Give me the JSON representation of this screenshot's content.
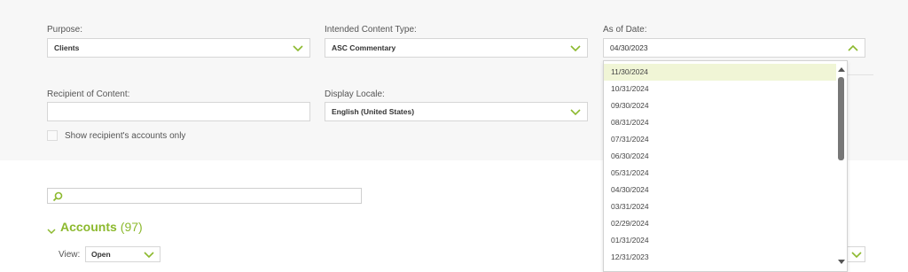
{
  "purpose": {
    "label": "Purpose:",
    "value": "Clients"
  },
  "content_type": {
    "label": "Intended Content Type:",
    "value": "ASC Commentary"
  },
  "as_of_date": {
    "label": "As of Date:",
    "value": "04/30/2023",
    "options": [
      "11/30/2024",
      "10/31/2024",
      "09/30/2024",
      "08/31/2024",
      "07/31/2024",
      "06/30/2024",
      "05/31/2024",
      "04/30/2024",
      "03/31/2024",
      "02/29/2024",
      "01/31/2024",
      "12/31/2023"
    ],
    "highlighted": "11/30/2024"
  },
  "recipient": {
    "label": "Recipient of Content:",
    "value": ""
  },
  "locale": {
    "label": "Display Locale:",
    "value": "English (United States)"
  },
  "show_accounts_only": {
    "label": "Show recipient's accounts only",
    "checked": false
  },
  "search": {
    "placeholder": ""
  },
  "accounts": {
    "title": "Accounts",
    "count": "(97)"
  },
  "view": {
    "label": "View:",
    "value": "Open"
  },
  "colors": {
    "accent": "#8cb92e",
    "highlight": "#f0f5d6",
    "panel": "#f7f7f7"
  },
  "icons": {
    "dropdown": "chevron-down-icon",
    "open_dropdown": "chevron-up-icon",
    "search": "search-icon",
    "collapse": "chevron-down-icon"
  }
}
